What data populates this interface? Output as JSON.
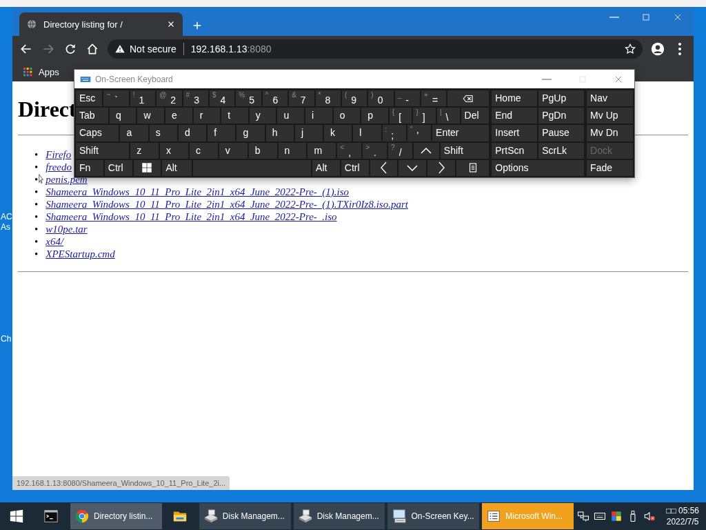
{
  "desktop": {
    "labels": [
      "AC",
      "As",
      "Ch"
    ]
  },
  "browser": {
    "tab": {
      "title": "Directory listing for /"
    },
    "nav_buttons": [
      {
        "kind": "back",
        "disabled": false
      },
      {
        "kind": "forward",
        "disabled": true
      },
      {
        "kind": "reload",
        "disabled": false
      },
      {
        "kind": "home",
        "disabled": false
      }
    ],
    "address": {
      "security": "Not secure",
      "host": "192.168.1.13",
      "port": ":8080"
    },
    "bookmarks": [
      {
        "label": "Apps"
      }
    ],
    "page": {
      "heading": "Direct",
      "files": [
        {
          "marker": "•",
          "name": "Firefo"
        },
        {
          "marker": "•",
          "name": "freedo"
        },
        {
          "marker": "•",
          "name": "penis.pem"
        },
        {
          "marker": "•",
          "name": "Shameera_Windows_10_11_Pro_Lite_2in1_x64_June_2022-Pre-_(1).iso"
        },
        {
          "marker": "•",
          "name": "Shameera_Windows_10_11_Pro_Lite_2in1_x64_June_2022-Pre-_(1).TXir0Iz8.iso.part"
        },
        {
          "marker": "•",
          "name": "Shameera_Windows_10_11_Pro_Lite_2in1_x64_June_2022-Pre-_.iso"
        },
        {
          "marker": "•",
          "name": "w10pe.tar"
        },
        {
          "marker": "•",
          "name": "x64/"
        },
        {
          "marker": "•",
          "name": "XPEStartup.cmd"
        }
      ]
    },
    "status_bubble": "192.168.1.13:8080/Shameera_Windows_10_11_Pro_Lite_2i..."
  },
  "keyboard": {
    "title": "On-Screen Keyboard",
    "main_rows": [
      [
        {
          "kind": "label",
          "label": "Esc"
        },
        {
          "kind": "char",
          "shift": "~",
          "label": "`"
        },
        {
          "kind": "char",
          "shift": "!",
          "label": "1"
        },
        {
          "kind": "char",
          "shift": "@",
          "label": "2"
        },
        {
          "kind": "char",
          "shift": "#",
          "label": "3"
        },
        {
          "kind": "char",
          "shift": "$",
          "label": "4"
        },
        {
          "kind": "char",
          "shift": "%",
          "label": "5"
        },
        {
          "kind": "char",
          "shift": "^",
          "label": "6"
        },
        {
          "kind": "char",
          "shift": "&",
          "label": "7"
        },
        {
          "kind": "char",
          "shift": "*",
          "label": "8"
        },
        {
          "kind": "char",
          "shift": "(",
          "label": "9"
        },
        {
          "kind": "char",
          "shift": ")",
          "label": "0"
        },
        {
          "kind": "char",
          "shift": "_",
          "label": "-"
        },
        {
          "kind": "char",
          "shift": "+",
          "label": "="
        },
        {
          "kind": "backspace"
        }
      ],
      [
        {
          "kind": "label",
          "label": "Tab"
        },
        {
          "kind": "letter",
          "label": "q"
        },
        {
          "kind": "letter",
          "label": "w"
        },
        {
          "kind": "letter",
          "label": "e"
        },
        {
          "kind": "letter",
          "label": "r"
        },
        {
          "kind": "letter",
          "label": "t"
        },
        {
          "kind": "letter",
          "label": "y"
        },
        {
          "kind": "letter",
          "label": "u"
        },
        {
          "kind": "letter",
          "label": "i"
        },
        {
          "kind": "letter",
          "label": "o"
        },
        {
          "kind": "letter",
          "label": "p"
        },
        {
          "kind": "char",
          "shift": "{",
          "label": "["
        },
        {
          "kind": "char",
          "shift": "}",
          "label": "]"
        },
        {
          "kind": "char",
          "shift": "|",
          "label": "\\"
        },
        {
          "kind": "label",
          "label": "Del"
        }
      ],
      [
        {
          "kind": "label",
          "label": "Caps"
        },
        {
          "kind": "letter",
          "label": "a"
        },
        {
          "kind": "letter",
          "label": "s"
        },
        {
          "kind": "letter",
          "label": "d"
        },
        {
          "kind": "letter",
          "label": "f"
        },
        {
          "kind": "letter",
          "label": "g"
        },
        {
          "kind": "letter",
          "label": "h"
        },
        {
          "kind": "letter",
          "label": "j"
        },
        {
          "kind": "letter",
          "label": "k"
        },
        {
          "kind": "letter",
          "label": "l"
        },
        {
          "kind": "char",
          "shift": ":",
          "label": ";"
        },
        {
          "kind": "char",
          "shift": "\"",
          "label": "'"
        },
        {
          "kind": "label",
          "label": "Enter"
        }
      ],
      [
        {
          "kind": "label",
          "label": "Shift"
        },
        {
          "kind": "letter",
          "label": "z"
        },
        {
          "kind": "letter",
          "label": "x"
        },
        {
          "kind": "letter",
          "label": "c"
        },
        {
          "kind": "letter",
          "label": "v"
        },
        {
          "kind": "letter",
          "label": "b"
        },
        {
          "kind": "letter",
          "label": "n"
        },
        {
          "kind": "letter",
          "label": "m"
        },
        {
          "kind": "char",
          "shift": "<",
          "label": ","
        },
        {
          "kind": "char",
          "shift": ">",
          "label": "."
        },
        {
          "kind": "char",
          "shift": "?",
          "label": "/"
        },
        {
          "kind": "up"
        },
        {
          "kind": "label",
          "label": "Shift"
        }
      ],
      [
        {
          "kind": "label",
          "label": "Fn"
        },
        {
          "kind": "label",
          "label": "Ctrl"
        },
        {
          "kind": "windows"
        },
        {
          "kind": "label",
          "label": "Alt"
        },
        {
          "kind": "space"
        },
        {
          "kind": "label",
          "label": "Alt"
        },
        {
          "kind": "label",
          "label": "Ctrl"
        },
        {
          "kind": "left"
        },
        {
          "kind": "down"
        },
        {
          "kind": "right"
        },
        {
          "kind": "menu"
        }
      ]
    ],
    "nav_rows": [
      [
        "Home",
        "PgUp"
      ],
      [
        "End",
        "PgDn"
      ],
      [
        "Insert",
        "Pause"
      ],
      [
        "PrtScn",
        "ScrLk"
      ],
      [
        "Options"
      ]
    ],
    "panel_keys": [
      {
        "label": "Nav",
        "disabled": false
      },
      {
        "label": "Mv Up",
        "disabled": false
      },
      {
        "label": "Mv Dn",
        "disabled": false
      },
      {
        "label": "Dock",
        "disabled": true
      },
      {
        "label": "Fade",
        "disabled": false
      }
    ]
  },
  "taskbar": {
    "items": [
      {
        "kind": "start",
        "active": false,
        "flashing": false
      },
      {
        "kind": "terminal",
        "active": false,
        "flashing": false
      },
      {
        "kind": "chrome",
        "label": "Directory listin...",
        "active": true,
        "flashing": false
      },
      {
        "kind": "folder",
        "active": false,
        "flashing": false
      },
      {
        "kind": "disk",
        "label": "Disk Managem...",
        "active": false,
        "flashing": false
      },
      {
        "kind": "disk",
        "label": "Disk Managem...",
        "active": false,
        "flashing": false
      },
      {
        "kind": "osk",
        "label": "On-Screen Key...",
        "active": false,
        "flashing": false
      },
      {
        "kind": "list",
        "label": "Microsoft Win...",
        "active": false,
        "flashing": true
      }
    ],
    "tray": [
      {
        "kind": "network"
      },
      {
        "kind": "keyboard"
      },
      {
        "kind": "color"
      },
      {
        "kind": "usb"
      },
      {
        "kind": "volume-muted"
      }
    ],
    "clock": {
      "time": "□□ 05:56",
      "date": "2022/7/5"
    }
  }
}
